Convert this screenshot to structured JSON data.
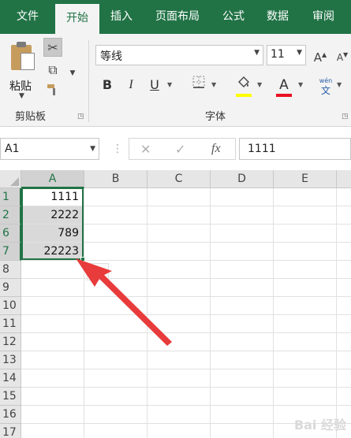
{
  "ribbon": {
    "tabs": [
      {
        "label": "文件"
      },
      {
        "label": "开始"
      },
      {
        "label": "插入"
      },
      {
        "label": "页面布局"
      },
      {
        "label": "公式"
      },
      {
        "label": "数据"
      },
      {
        "label": "审阅"
      }
    ],
    "active_tab": "开始",
    "clipboard": {
      "paste_label": "粘贴",
      "group_label": "剪贴板"
    },
    "font": {
      "font_name": "等线",
      "font_size": "11",
      "group_label": "字体",
      "bold_label": "B",
      "italic_label": "I",
      "underline_label": "U",
      "grow_label": "A",
      "shrink_label": "A",
      "font_color_label": "A",
      "phonetic_top": "wén",
      "phonetic_bottom": "文"
    },
    "colors": {
      "accent": "#217346",
      "fill_color": "#ffff00",
      "font_color": "#e81123"
    }
  },
  "formula_bar": {
    "name_box": "A1",
    "fx_label": "fx",
    "formula_value": "1111"
  },
  "grid": {
    "columns": [
      "A",
      "B",
      "C",
      "D",
      "E"
    ],
    "rows": [
      {
        "row_label": "1",
        "a_value": "1111"
      },
      {
        "row_label": "2",
        "a_value": "2222"
      },
      {
        "row_label": "6",
        "a_value": "789"
      },
      {
        "row_label": "7",
        "a_value": "22223"
      },
      {
        "row_label": "8",
        "a_value": ""
      },
      {
        "row_label": "9",
        "a_value": ""
      },
      {
        "row_label": "10",
        "a_value": ""
      },
      {
        "row_label": "11",
        "a_value": ""
      },
      {
        "row_label": "12",
        "a_value": ""
      },
      {
        "row_label": "13",
        "a_value": ""
      },
      {
        "row_label": "14",
        "a_value": ""
      },
      {
        "row_label": "15",
        "a_value": ""
      },
      {
        "row_label": "16",
        "a_value": ""
      },
      {
        "row_label": "17",
        "a_value": ""
      }
    ]
  },
  "icons": {
    "cut": "scissors-icon",
    "copy": "copy-icon",
    "format_painter": "paintbrush-icon",
    "borders": "borders-icon",
    "fill_color": "paint-bucket-icon",
    "annotation": "red-arrow"
  },
  "watermark": "Bai 经验"
}
